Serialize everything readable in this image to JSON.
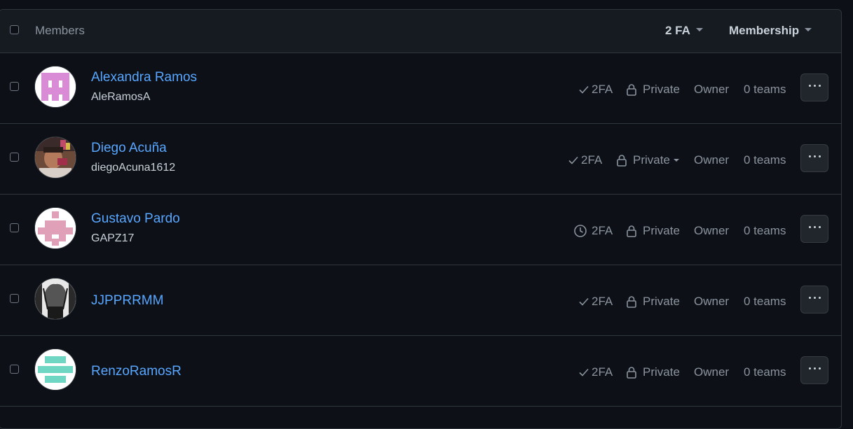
{
  "header": {
    "title": "Members",
    "filter_2fa": "2 FA",
    "filter_membership": "Membership"
  },
  "members": [
    {
      "name": "Alexandra Ramos",
      "login": "AleRamosA",
      "twofa": "2FA",
      "twofa_status": "check",
      "visibility": "Private",
      "role": "Owner",
      "teams": "0 teams",
      "avatar": "purple-identicon"
    },
    {
      "name": "Diego Acuña",
      "login": "diegoAcuna1612",
      "twofa": "2FA",
      "twofa_status": "check",
      "visibility": "Private",
      "role": "Owner",
      "teams": "0 teams",
      "avatar": "photo"
    },
    {
      "name": "Gustavo Pardo",
      "login": "GAPZ17",
      "twofa": "2FA",
      "twofa_status": "pending",
      "visibility": "Private",
      "role": "Owner",
      "teams": "0 teams",
      "avatar": "pink-identicon"
    },
    {
      "name": "JJPPRRMM",
      "login": "",
      "twofa": "2FA",
      "twofa_status": "check",
      "visibility": "Private",
      "role": "Owner",
      "teams": "0 teams",
      "avatar": "drawing"
    },
    {
      "name": "RenzoRamosR",
      "login": "",
      "twofa": "2FA",
      "twofa_status": "check",
      "visibility": "Private",
      "role": "Owner",
      "teams": "0 teams",
      "avatar": "teal-identicon"
    }
  ],
  "colors": {
    "background": "#0d1117",
    "header_bg": "#161b22",
    "border": "#30363d",
    "link": "#58a6ff",
    "muted": "#8b949e"
  }
}
